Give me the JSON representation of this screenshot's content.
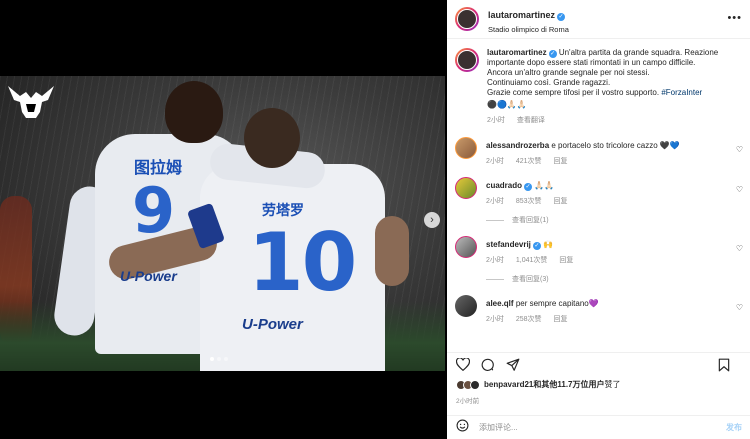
{
  "media": {
    "jersey_9_name": "图拉姆",
    "jersey_9_number": "9",
    "jersey_10_name": "劳塔罗",
    "jersey_10_number": "10",
    "sponsor_9": "U-Power",
    "sponsor_10": "U-Power",
    "next_glyph": "›"
  },
  "header": {
    "username": "lautaromartinez",
    "location": "Stadio olimpico di Roma",
    "more_glyph": "•••"
  },
  "caption": {
    "username": "lautaromartinez",
    "text_lines": [
      "Un'altra partita da grande squadra. Reazione importante dopo essere stati rimontati in un campo difficile.",
      "Ancora un'altro grande segnale per noi stessi.",
      "Continuiamo così. Grande ragazzi.",
      "Grazie come sempre tifosi per il vostro supporto."
    ],
    "hashtag": "#ForzaInter",
    "emojis": "⚫🔵🙏🏻🙏🏻",
    "time": "2小时",
    "translate": "查看翻译"
  },
  "comments": [
    {
      "username": "alessandrozerba",
      "verified": false,
      "text": "e portacelo sto tricolore cazzo 🖤💙",
      "time": "2小时",
      "likes": "421次赞",
      "reply": "回复",
      "view_replies": ""
    },
    {
      "username": "cuadrado",
      "verified": true,
      "text": "🙏🏻🙏🏻",
      "time": "2小时",
      "likes": "853次赞",
      "reply": "回复",
      "view_replies": "查看回复(1)"
    },
    {
      "username": "stefandevrij",
      "verified": true,
      "text": "🙌",
      "time": "2小时",
      "likes": "1,041次赞",
      "reply": "回复",
      "view_replies": "查看回复(3)"
    },
    {
      "username": "alee.qlf",
      "verified": false,
      "text": "per sempre capitano💜",
      "time": "2小时",
      "likes": "258次赞",
      "reply": "回复",
      "view_replies": ""
    }
  ],
  "likes": {
    "user": "benpavard21",
    "rest": "和其他11.7万位用户",
    "suffix": "赞了"
  },
  "post_time": "2小时前",
  "add_comment": {
    "placeholder": "添加评论...",
    "post_label": "发布"
  },
  "colors": {
    "verified": "#3897f0",
    "hashtag": "#00376b",
    "muted": "#8e8e8e",
    "post_disabled": "#a7d2f7"
  }
}
